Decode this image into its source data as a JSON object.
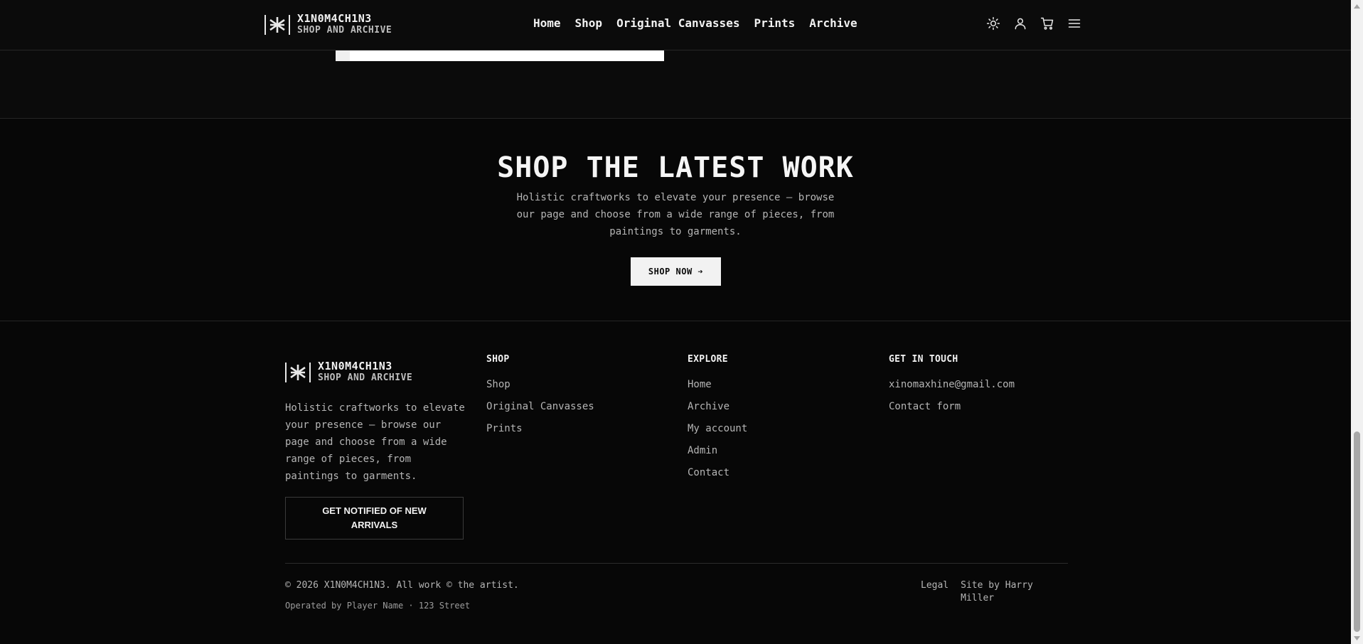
{
  "brand": {
    "name": "X1N0M4CH1N3",
    "subtitle": "SHOP AND ARCHIVE"
  },
  "nav": {
    "items": [
      "Home",
      "Shop",
      "Original Canvasses",
      "Prints",
      "Archive"
    ]
  },
  "header_icons": [
    "sun-icon",
    "user-icon",
    "cart-icon",
    "menu-icon"
  ],
  "cta": {
    "title": "SHOP THE LATEST WORK",
    "description": "Holistic craftworks to elevate your presence — browse our page and choose from a wide range of pieces, from paintings to garments.",
    "button": "SHOP NOW ➔"
  },
  "footer": {
    "description": "Holistic craftworks to elevate your presence — browse our page and choose from a wide range of pieces, from paintings to garments.",
    "notify_button": "GET NOTIFIED OF NEW ARRIVALS",
    "shop": {
      "heading": "SHOP",
      "links": [
        "Shop",
        "Original Canvasses",
        "Prints"
      ]
    },
    "explore": {
      "heading": "EXPLORE",
      "links": [
        "Home",
        "Archive",
        "My account",
        "Admin",
        "Contact"
      ]
    },
    "contact": {
      "heading": "GET IN TOUCH",
      "links": [
        "xinomaxhine@gmail.com",
        "Contact form"
      ]
    },
    "copyright": "© 2026 X1N0M4CH1N3. All work © the artist.",
    "operated": "Operated by Player Name · 123 Street",
    "bottom_links": [
      "Legal",
      "Site by Harry Miller"
    ]
  },
  "colors": {
    "background": "#0b0b0b",
    "text": "#e8e8e8",
    "muted": "#b5b5b5",
    "button_bg": "#f2f2f2"
  }
}
